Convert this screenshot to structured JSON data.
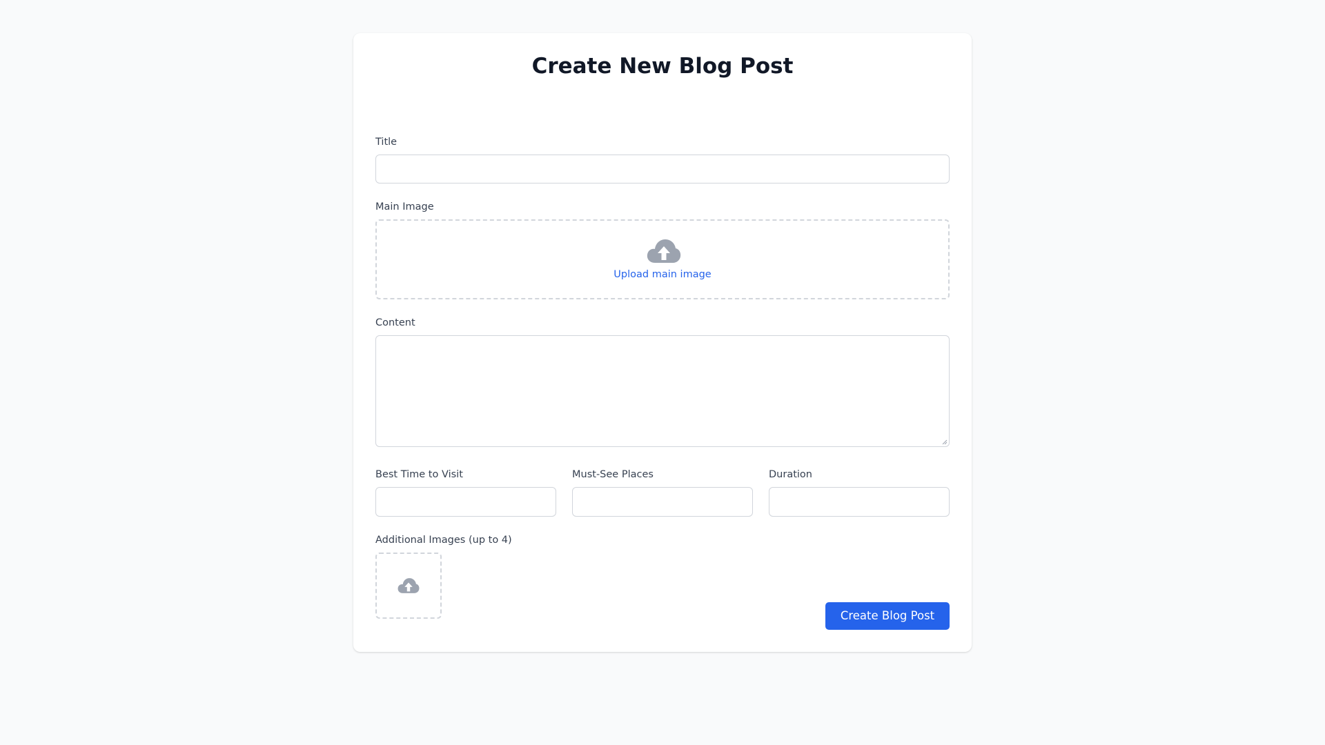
{
  "form": {
    "heading": "Create New Blog Post",
    "title_label": "Title",
    "title_value": "",
    "main_image_label": "Main Image",
    "main_image_upload_text": "Upload main image",
    "upload_icon": "cloud-upload-icon",
    "content_label": "Content",
    "content_value": "",
    "best_time_label": "Best Time to Visit",
    "best_time_value": "",
    "must_see_label": "Must-See Places",
    "must_see_value": "",
    "duration_label": "Duration",
    "duration_value": "",
    "additional_images_label": "Additional Images (up to 4)",
    "submit_label": "Create Blog Post"
  },
  "colors": {
    "page_background": "#f9fafb",
    "card_background": "#ffffff",
    "heading_text": "#111827",
    "label_text": "#374151",
    "border": "#d1d5db",
    "icon_gray": "#9ca3af",
    "accent_blue": "#2563eb"
  }
}
